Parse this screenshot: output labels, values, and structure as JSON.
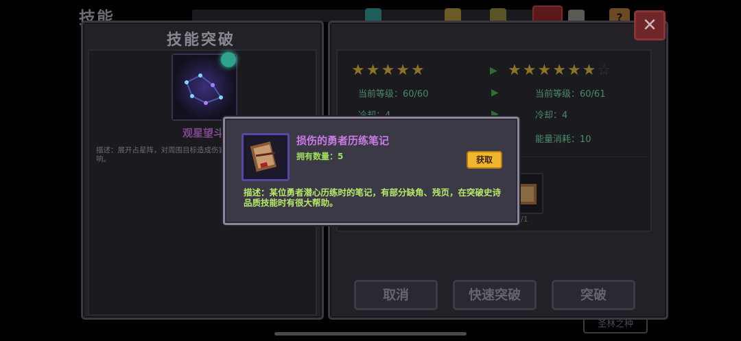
{
  "background": {
    "screen_title": "技能",
    "help_label": "?",
    "bottom_button": "圣林之种"
  },
  "left_panel": {
    "title": "技能突破",
    "skill_name": "观星望斗",
    "skill_desc": "描述：展开占星阵，对周围目标造成伤害，该技能不受冷却缩减影响。"
  },
  "right_panel": {
    "current_stars": 5,
    "next_stars": 6,
    "max_stars": 7,
    "current": {
      "level": "当前等级：60/60",
      "cooldown": "冷却：4"
    },
    "next": {
      "level": "当前等级：60/61",
      "cooldown": "冷却：4",
      "energy": "能量消耗：10"
    },
    "material_count": "0/1",
    "buttons": {
      "cancel": "取消",
      "quick_break": "快速突破",
      "break": "突破"
    },
    "close": "✕"
  },
  "popup": {
    "item_name": "损伤的勇者历练笔记",
    "owned": "拥有数量：5",
    "get_button": "获取",
    "description": "描述：某位勇者潜心历练时的笔记，有部分缺角、残页，在突破史诗品质技能时有很大帮助。"
  },
  "colors": {
    "star": "#8a7426",
    "item_name": "#c97be6",
    "item_desc": "#b7e86a",
    "get_button": "#f0b72e",
    "close_button": "#6e2628"
  }
}
